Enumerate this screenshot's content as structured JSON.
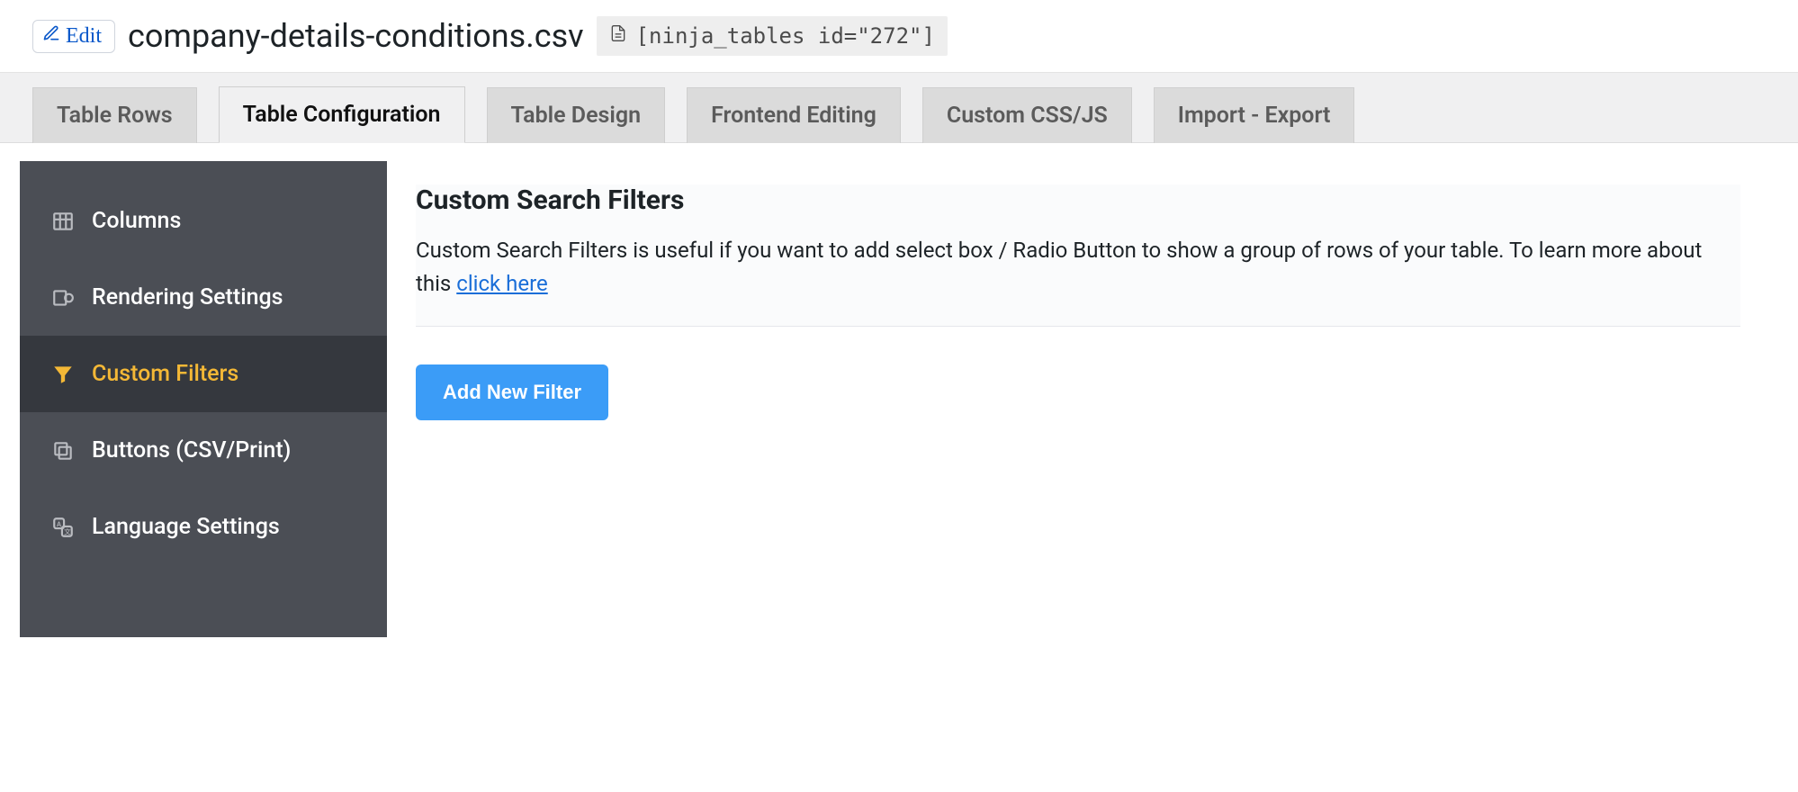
{
  "header": {
    "edit_label": "Edit",
    "title": "company-details-conditions.csv",
    "shortcode": "[ninja_tables id=\"272\"]"
  },
  "tabs": [
    {
      "label": "Table Rows",
      "active": false
    },
    {
      "label": "Table Configuration",
      "active": true
    },
    {
      "label": "Table Design",
      "active": false
    },
    {
      "label": "Frontend Editing",
      "active": false
    },
    {
      "label": "Custom CSS/JS",
      "active": false
    },
    {
      "label": "Import - Export",
      "active": false
    }
  ],
  "sidebar": {
    "items": [
      {
        "label": "Columns",
        "icon": "columns-icon",
        "active": false
      },
      {
        "label": "Rendering Settings",
        "icon": "rendering-icon",
        "active": false
      },
      {
        "label": "Custom Filters",
        "icon": "filter-icon",
        "active": true
      },
      {
        "label": "Buttons (CSV/Print)",
        "icon": "buttons-icon",
        "active": false
      },
      {
        "label": "Language Settings",
        "icon": "language-icon",
        "active": false
      }
    ]
  },
  "panel": {
    "heading": "Custom Search Filters",
    "description_pre": "Custom Search Filters is useful if you want to add select box / Radio Button to show a group of rows of your table. To learn more about this ",
    "link_text": "click here",
    "add_button": "Add New Filter"
  }
}
